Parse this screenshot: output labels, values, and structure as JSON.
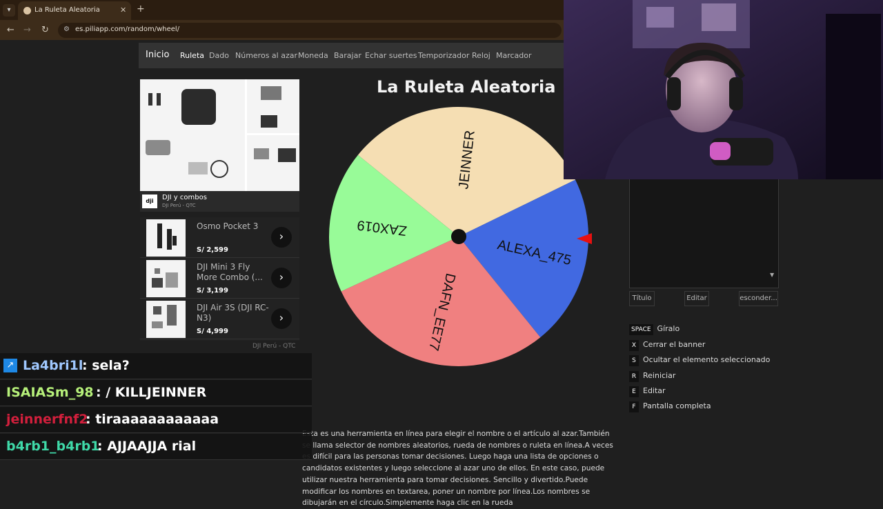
{
  "browser": {
    "tab_title": "La Ruleta Aleatoria",
    "new_tab": "+",
    "url": "es.piliapp.com/random/wheel/"
  },
  "nav": {
    "home": "Inicio",
    "links": [
      "Ruleta",
      "Dado",
      "Números al azar",
      "Moneda",
      "Barajar",
      "Echar suertes",
      "Temporizador",
      "Reloj",
      "Marcador"
    ],
    "active": "Ruleta"
  },
  "ad": {
    "brand": "DJI y combos",
    "brand_sub": "DJI Perú - QTC",
    "products": [
      {
        "name": "Osmo Pocket 3",
        "price": "S/ 2,599"
      },
      {
        "name": "DJI Mini 3 Fly More Combo (...",
        "price": "S/ 3,199"
      },
      {
        "name": "DJI Air 3S (DJI RC-N3)",
        "price": "S/ 4,999"
      }
    ],
    "footer": "DJI Perú - QTC"
  },
  "wheel": {
    "title": "La Ruleta Aleatoria",
    "segments": [
      {
        "name": "JEINNER",
        "color": "#f5deb3"
      },
      {
        "name": "ALEXA_475",
        "color": "#4169e1"
      },
      {
        "name": "DAFN_EE77",
        "color": "#f08080"
      },
      {
        "name": "ZAX019",
        "color": "#98fb98"
      }
    ],
    "pointer_color": "#e81010"
  },
  "panel": {
    "title_btn": "Título",
    "edit_btn": "Editar",
    "hide_btn": "esconder...",
    "shortcuts": [
      {
        "key": "SPACE",
        "label": "Gíralo"
      },
      {
        "key": "X",
        "label": "Cerrar el banner"
      },
      {
        "key": "S",
        "label": "Ocultar el elemento seleccionado"
      },
      {
        "key": "R",
        "label": "Reiniciar"
      },
      {
        "key": "E",
        "label": "Editar"
      },
      {
        "key": "F",
        "label": "Pantalla completa"
      }
    ]
  },
  "description": "Esta es una herramienta en línea para elegir el nombre o el artículo al azar.También se llama selector de nombres aleatorios, rueda de nombres o ruleta en línea.A veces es difícil para las personas tomar decisiones. Luego haga una lista de opciones o candidatos existentes y luego seleccione al azar uno de ellos. En este caso, puede utilizar nuestra herramienta para tomar decisiones. Sencillo y divertido.Puede modificar los nombres en textarea, poner un nombre por línea.Los nombres se dibujarán en el círculo.Simplemente haga clic en la rueda",
  "chat": [
    {
      "user": "La4bri1l",
      "message": ": sela?",
      "color": "#a0c8ff"
    },
    {
      "user": "ISAIASm_98",
      "message": ": / KILLJEINNER",
      "color": "#b6f07a"
    },
    {
      "user": "jeinnerfnf2",
      "message": ": tiraaaaaaaaaaaa",
      "color": "#d21f3c"
    },
    {
      "user": "b4rb1_b4rb1",
      "message": ": AJJAAJJA rial",
      "color": "#3fd9a8"
    }
  ]
}
